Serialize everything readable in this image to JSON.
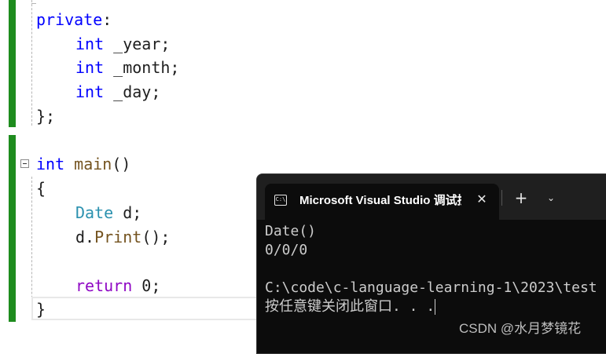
{
  "editor": {
    "lines": [
      {
        "parts": [
          {
            "t": "private",
            "c": "kw"
          },
          {
            "t": ":",
            "c": "plain"
          }
        ]
      },
      {
        "parts": [
          {
            "t": "int",
            "c": "kw"
          },
          {
            "t": " _year;",
            "c": "plain"
          }
        ]
      },
      {
        "parts": [
          {
            "t": "int",
            "c": "kw"
          },
          {
            "t": " _month;",
            "c": "plain"
          }
        ]
      },
      {
        "parts": [
          {
            "t": "int",
            "c": "kw"
          },
          {
            "t": " _day;",
            "c": "plain"
          }
        ]
      },
      {
        "parts": [
          {
            "t": "};",
            "c": "plain"
          }
        ]
      },
      {
        "parts": [
          {
            "t": "int",
            "c": "kw"
          },
          {
            "t": " ",
            "c": "plain"
          },
          {
            "t": "main",
            "c": "fn"
          },
          {
            "t": "()",
            "c": "plain"
          }
        ]
      },
      {
        "parts": [
          {
            "t": "{",
            "c": "plain"
          }
        ]
      },
      {
        "parts": [
          {
            "t": "Date",
            "c": "type"
          },
          {
            "t": " d;",
            "c": "plain"
          }
        ]
      },
      {
        "parts": [
          {
            "t": "d.",
            "c": "plain"
          },
          {
            "t": "Print",
            "c": "fn"
          },
          {
            "t": "();",
            "c": "plain"
          }
        ]
      },
      {
        "parts": [
          {
            "t": "return",
            "c": "kw-ret"
          },
          {
            "t": " 0;",
            "c": "plain"
          }
        ]
      },
      {
        "parts": [
          {
            "t": "}",
            "c": "plain"
          }
        ]
      }
    ]
  },
  "terminal": {
    "tab_icon": "C:\\",
    "tab_title": "Microsoft Visual Studio 调试控制台",
    "close_glyph": "✕",
    "new_tab_glyph": "+",
    "dropdown_glyph": "⌄",
    "output": [
      "Date()",
      "0/0/0",
      "",
      "C:\\code\\c-language-learning-1\\2023\\test",
      "按任意键关闭此窗口. . ."
    ]
  },
  "watermark": "CSDN @水月梦镜花",
  "colors": {
    "keyword": "#0000ff",
    "return_keyword": "#8f08c4",
    "type": "#2b91af",
    "function": "#74531f",
    "change_bar": "#1e8c1e",
    "terminal_bg": "#0c0c0c"
  }
}
